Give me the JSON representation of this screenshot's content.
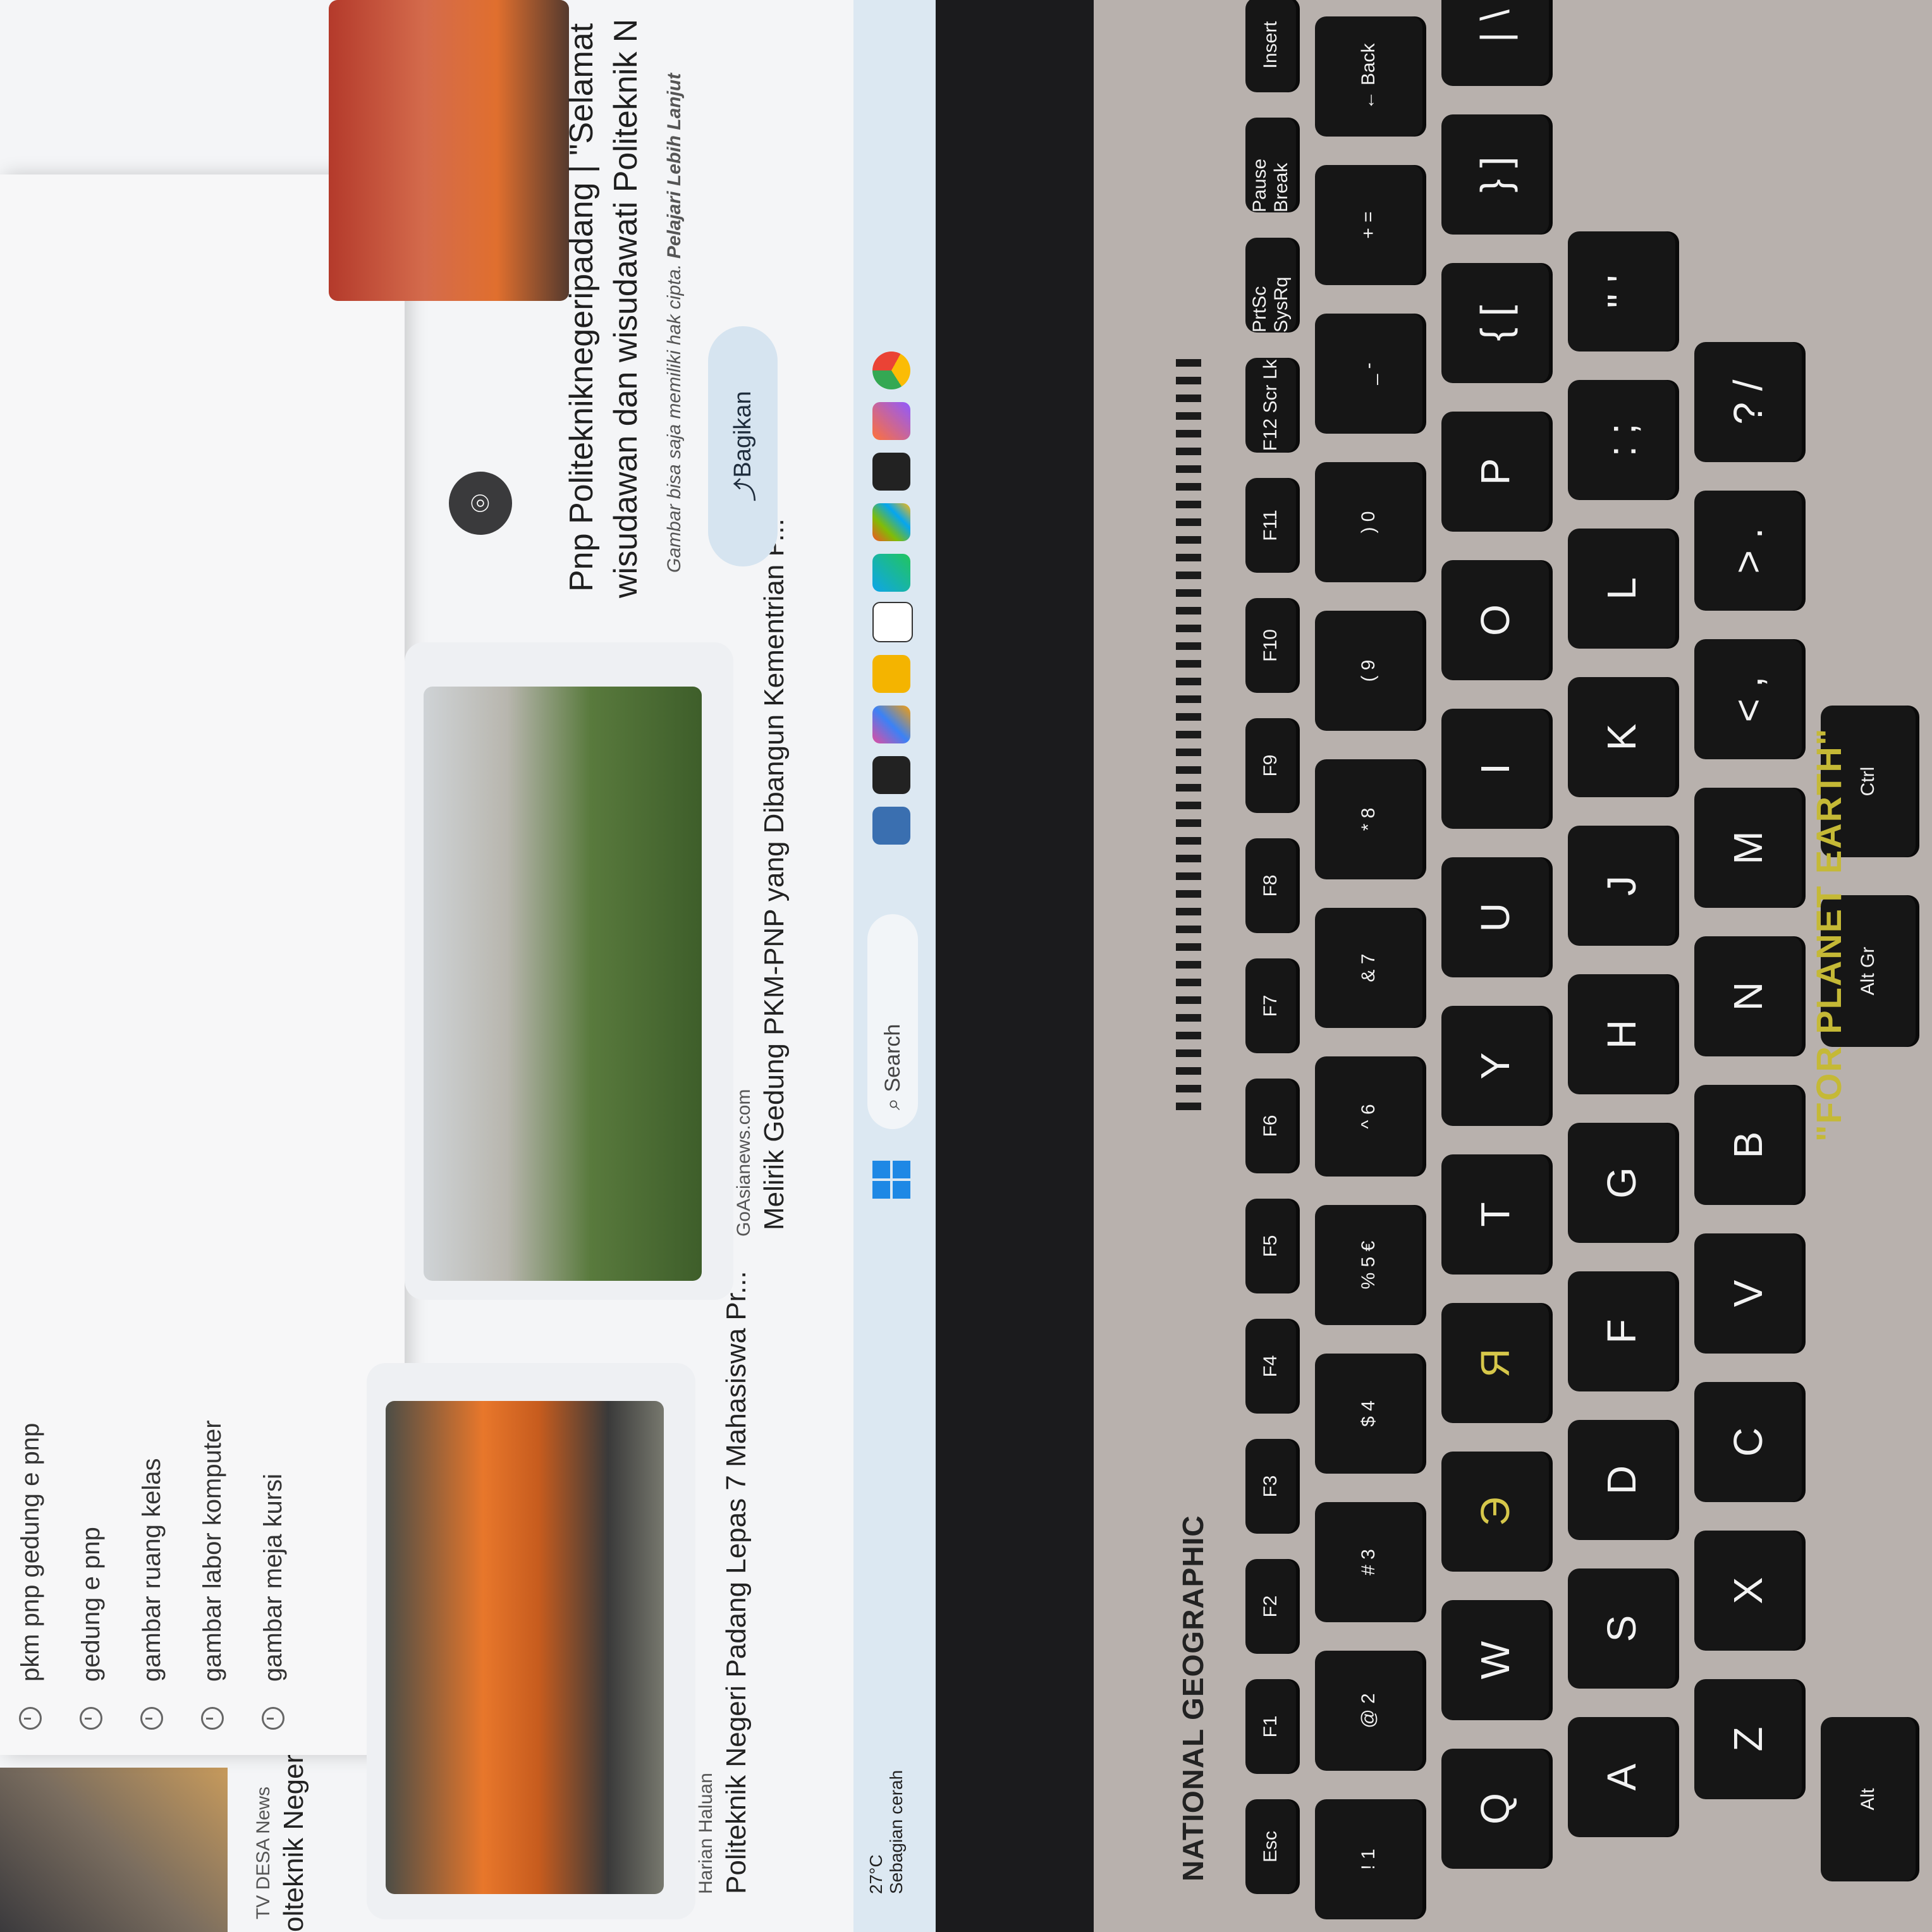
{
  "suggestions": [
    "pkm pnp gedung e pnp",
    "gedung e pnp",
    "gambar ruang kelas",
    "gambar labor komputer",
    "gambar meja kursi"
  ],
  "cards": [
    {
      "source": "TV DESA News",
      "headline": "olteknik Negeri"
    },
    {
      "source": "Harian Haluan",
      "headline": "Politeknik Negeri Padang Lepas 7 Mahasiswa Pr..."
    },
    {
      "source": "GoAsianews.com",
      "headline": "Melirik Gedung PKM-PNP yang Dibangun Kementrian P..."
    }
  ],
  "detail": {
    "title_line1": "Pnp Politekniknegeripadang | \"Selamat",
    "title_line2": "wisudawan dan wisudawati Politeknik N",
    "note": "Gambar bisa saja memiliki hak cipta.",
    "learn_more": "Pelajari Lebih Lanjut",
    "share_label": "Bagikan"
  },
  "taskbar": {
    "temperature": "27°C",
    "weather": "Sebagian cerah",
    "search_label": "Search"
  },
  "keyboard": {
    "brand": "NATIONAL GEOGRAPHIC",
    "slogan": "\"FOR PLANET EARTH\"",
    "row_fn": [
      "Esc",
      "F1",
      "F2",
      "F3",
      "F4",
      "F5",
      "F6",
      "F7",
      "F8",
      "F9",
      "F10",
      "F11",
      "F12 Scr Lk",
      "PrtSc SysRq",
      "Pause Break",
      "Insert"
    ],
    "row_num": [
      "! 1",
      "@ 2",
      "# 3",
      "$ 4",
      "% 5 €",
      "^ 6",
      "& 7",
      "* 8",
      "( 9",
      ") 0",
      "_ -",
      "+ =",
      "← Back"
    ],
    "row_q": [
      "Q",
      "W",
      "Э",
      "Я",
      "T",
      "Y",
      "U",
      "I",
      "O",
      "P",
      "{ [",
      "} ]",
      "| \\"
    ],
    "row_a": [
      "A",
      "S",
      "D",
      "F",
      "G",
      "H",
      "J",
      "K",
      "L",
      ": ;",
      "\" '"
    ],
    "row_z": [
      "Z",
      "X",
      "C",
      "V",
      "B",
      "N",
      "M",
      "< ,",
      "> .",
      "? /"
    ],
    "row_bottom": [
      "Alt",
      "Alt Gr",
      "Ctrl"
    ]
  }
}
